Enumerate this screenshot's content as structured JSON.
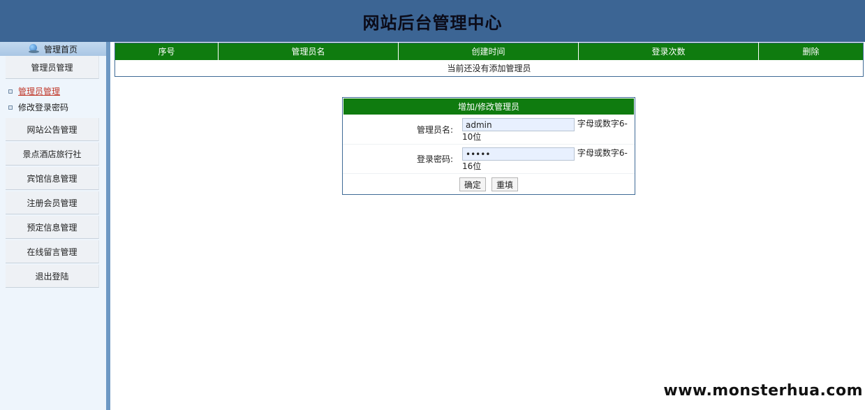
{
  "header": {
    "title": "网站后台管理中心"
  },
  "sidebar": {
    "home_label": "管理首页",
    "group_title": "管理员管理",
    "sub_items": [
      {
        "label": "管理员管理",
        "active": true
      },
      {
        "label": "修改登录密码",
        "active": false
      }
    ],
    "menu": [
      {
        "label": "网站公告管理"
      },
      {
        "label": "景点酒店旅行社"
      },
      {
        "label": "宾馆信息管理"
      },
      {
        "label": "注册会员管理"
      },
      {
        "label": "预定信息管理"
      },
      {
        "label": "在线留言管理"
      },
      {
        "label": "退出登陆"
      }
    ]
  },
  "table": {
    "columns": [
      "序号",
      "管理员名",
      "创建时间",
      "登录次数",
      "删除"
    ],
    "empty_message": "当前还没有添加管理员"
  },
  "form": {
    "title": "增加/修改管理员",
    "username_label": "管理员名:",
    "username_value": "admin",
    "username_hint": "字母或数字6-10位",
    "password_label": "登录密码:",
    "password_value": "•••••",
    "password_hint": "字母或数字6-16位",
    "confirm_label": "确定",
    "reset_label": "重填"
  },
  "watermark": "www.monsterhua.com",
  "colors": {
    "header_bg": "#3c6594",
    "table_head": "#0f7b0f",
    "sidebar_bg": "#eef5fc"
  }
}
